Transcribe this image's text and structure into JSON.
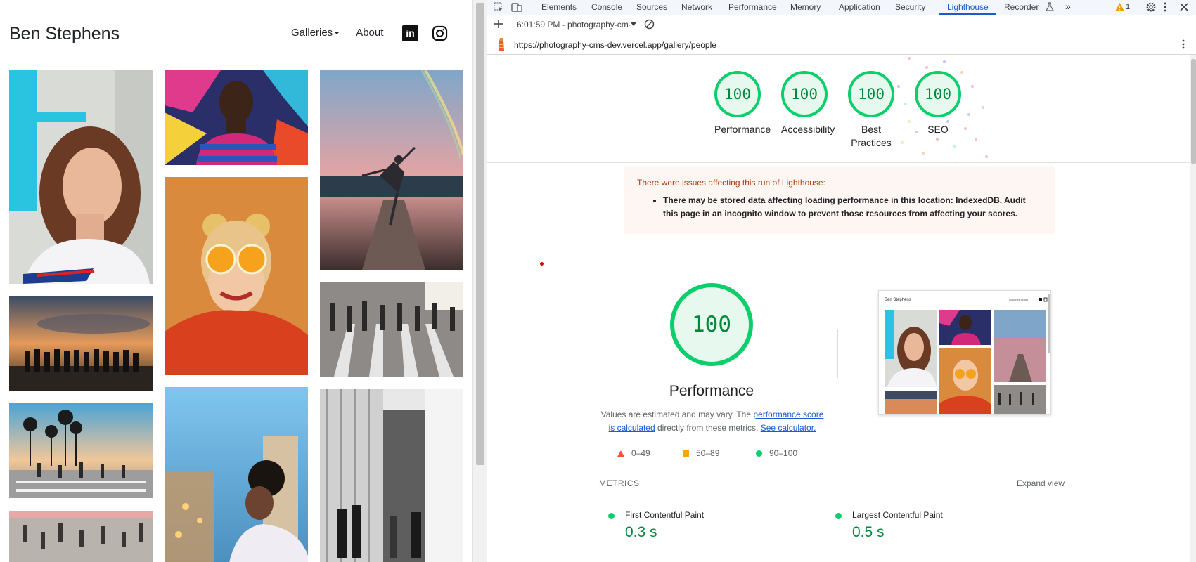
{
  "site": {
    "title": "Ben Stephens",
    "nav": {
      "galleries": "Galleries",
      "about": "About"
    },
    "social": {
      "linkedin": "in"
    }
  },
  "devtools": {
    "tabs": [
      "Elements",
      "Console",
      "Sources",
      "Network",
      "Performance",
      "Memory",
      "Application",
      "Security",
      "Lighthouse",
      "Recorder",
      "»"
    ],
    "active_tab": "Lighthouse",
    "warning_count": "1",
    "report_time": "6:01:59 PM - photography-cm·",
    "url": "https://photography-cms-dev.vercel.app/gallery/people"
  },
  "lighthouse": {
    "scores": [
      {
        "label": "Performance",
        "score": "100"
      },
      {
        "label": "Accessibility",
        "score": "100"
      },
      {
        "label": "Best Practices",
        "score": "100"
      },
      {
        "label": "SEO",
        "score": "100"
      }
    ],
    "warning": {
      "title": "There were issues affecting this run of Lighthouse:",
      "item": "There may be stored data affecting loading performance in this location: IndexedDB. Audit this page in an incognito window to prevent those resources from affecting your scores."
    },
    "performance": {
      "score": "100",
      "title": "Performance",
      "desc_prefix": "Values are estimated and may vary. The ",
      "desc_link1": "performance score is calculated",
      "desc_middle": " directly from these metrics. ",
      "desc_link2": "See calculator."
    },
    "legend": {
      "fail": "0–49",
      "average": "50–89",
      "pass": "90–100"
    },
    "thumbnail": {
      "title": "Ben Stephens",
      "nav": "Galleries  About"
    },
    "metrics_label": "METRICS",
    "expand_label": "Expand view",
    "metrics": [
      {
        "name": "First Contentful Paint",
        "value": "0.3 s"
      },
      {
        "name": "Largest Contentful Paint",
        "value": "0.5 s"
      }
    ],
    "colors": {
      "pass": "#0cce6b",
      "pass_text": "#008a3a",
      "average": "#ffa400",
      "fail": "#ff4e42",
      "accent": "#1a5ad7"
    }
  }
}
